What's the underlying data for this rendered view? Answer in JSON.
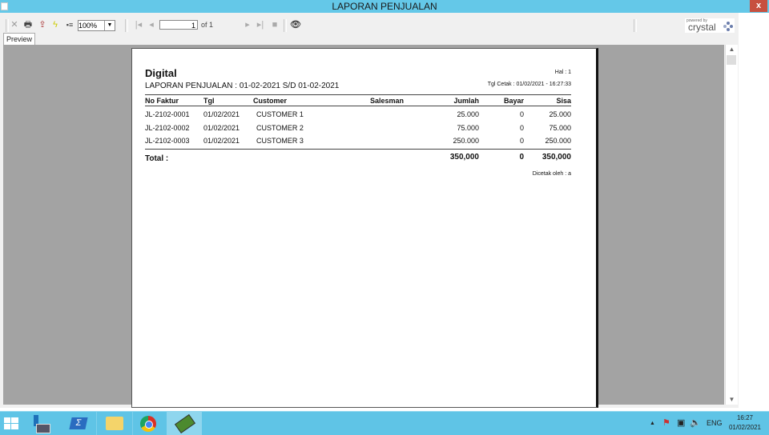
{
  "window": {
    "title": "LAPORAN PENJUALAN",
    "close_label": "x"
  },
  "toolbar": {
    "zoom_value": "100%",
    "page_current": "1",
    "page_total_label": "of 1",
    "brand_powered": "powered by",
    "brand_name": "crystal"
  },
  "tabs": [
    {
      "label": "Preview"
    }
  ],
  "report": {
    "company": "Digital",
    "subtitle": "LAPORAN PENJUALAN : 01-02-2021 S/D 01-02-2021",
    "page_label": "Hal : 1",
    "print_date": "Tgl Cetak : 01/02/2021 - 16:27:33",
    "columns": [
      "No Faktur",
      "Tgl",
      "Customer",
      "Salesman",
      "Jumlah",
      "Bayar",
      "Sisa"
    ],
    "rows": [
      {
        "no_faktur": "JL-2102-0001",
        "tgl": "01/02/2021",
        "customer": "CUSTOMER 1",
        "salesman": "",
        "jumlah": "25.000",
        "bayar": "0",
        "sisa": "25.000"
      },
      {
        "no_faktur": "JL-2102-0002",
        "tgl": "01/02/2021",
        "customer": "CUSTOMER 2",
        "salesman": "",
        "jumlah": "75.000",
        "bayar": "0",
        "sisa": "75.000"
      },
      {
        "no_faktur": "JL-2102-0003",
        "tgl": "01/02/2021",
        "customer": "CUSTOMER 3",
        "salesman": "",
        "jumlah": "250.000",
        "bayar": "0",
        "sisa": "250.000"
      }
    ],
    "total_label": "Total :",
    "total_jumlah": "350,000",
    "total_bayar": "0",
    "total_sisa": "350,000",
    "printed_by": "Dicetak oleh : a"
  },
  "taskbar": {
    "language": "ENG",
    "time": "16:27",
    "date": "01/02/2021"
  }
}
